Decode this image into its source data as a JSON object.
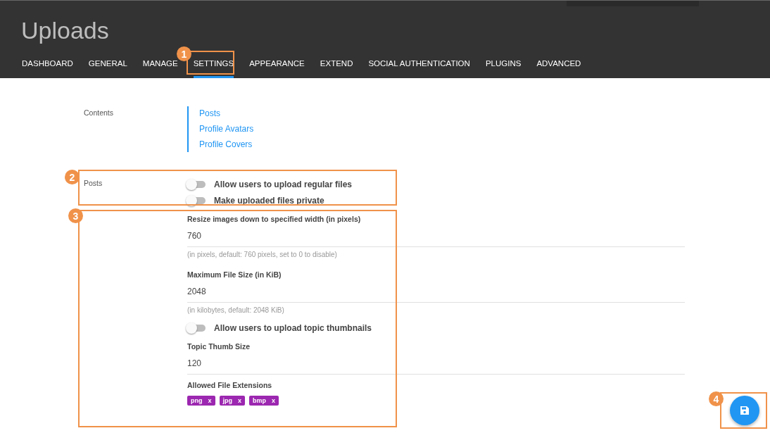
{
  "header": {
    "title": "Uploads"
  },
  "tabs": [
    {
      "label": "DASHBOARD",
      "selected": false
    },
    {
      "label": "GENERAL",
      "selected": false
    },
    {
      "label": "MANAGE",
      "selected": false
    },
    {
      "label": "SETTINGS",
      "selected": true
    },
    {
      "label": "APPEARANCE",
      "selected": false
    },
    {
      "label": "EXTEND",
      "selected": false
    },
    {
      "label": "SOCIAL AUTHENTICATION",
      "selected": false
    },
    {
      "label": "PLUGINS",
      "selected": false
    },
    {
      "label": "ADVANCED",
      "selected": false
    }
  ],
  "contents": {
    "label": "Contents",
    "links": [
      "Posts",
      "Profile Avatars",
      "Profile Covers"
    ]
  },
  "posts": {
    "label": "Posts",
    "items": [
      {
        "kind": "toggle",
        "label": "Allow users to upload regular files",
        "checked": false
      },
      {
        "kind": "toggle",
        "label": "Make uploaded files private",
        "checked": false
      },
      {
        "kind": "input",
        "label": "Resize images down to specified width (in pixels)",
        "value": "760",
        "help": "(in pixels, default: 760 pixels, set to 0 to disable)"
      },
      {
        "kind": "input",
        "label": "Maximum File Size (in KiB)",
        "value": "2048",
        "help": "(in kilobytes, default: 2048 KiB)"
      },
      {
        "kind": "toggle",
        "label": "Allow users to upload topic thumbnails",
        "checked": false
      },
      {
        "kind": "input",
        "label": "Topic Thumb Size",
        "value": "120"
      },
      {
        "kind": "tags",
        "label": "Allowed File Extensions",
        "tags": [
          {
            "text": "png",
            "remove": "x"
          },
          {
            "text": "jpg",
            "remove": "x"
          },
          {
            "text": "bmp",
            "remove": "x"
          }
        ]
      }
    ]
  },
  "annotations": [
    "1",
    "2",
    "3",
    "4"
  ]
}
